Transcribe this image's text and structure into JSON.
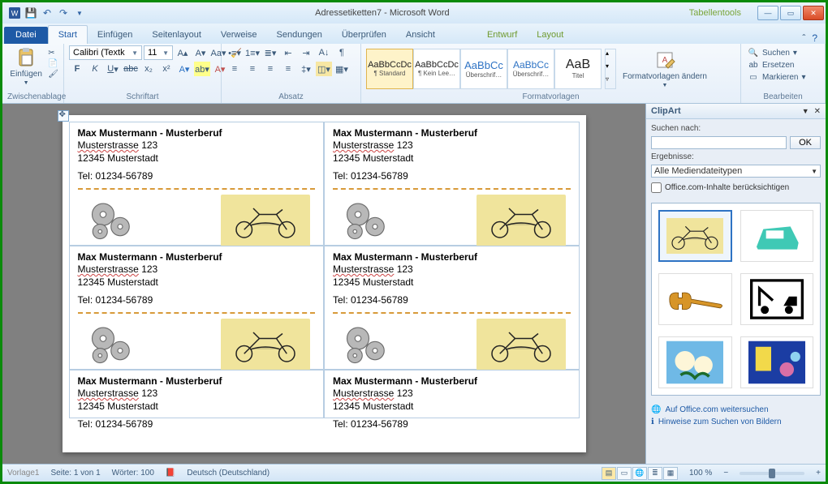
{
  "title": {
    "doc": "Adressetiketten7",
    "app": "Microsoft Word",
    "context_tool": "Tabellentools"
  },
  "tabs": {
    "file": "Datei",
    "items": [
      "Start",
      "Einfügen",
      "Seitenlayout",
      "Verweise",
      "Sendungen",
      "Überprüfen",
      "Ansicht"
    ],
    "context": [
      "Entwurf",
      "Layout"
    ]
  },
  "ribbon": {
    "clipboard": {
      "paste": "Einfügen",
      "label": "Zwischenablage"
    },
    "font": {
      "name": "Calibri (Textk",
      "size": "11",
      "label": "Schriftart"
    },
    "para": {
      "label": "Absatz"
    },
    "styles": {
      "label": "Formatvorlagen",
      "change": "Formatvorlagen ändern",
      "items": [
        {
          "sample": "AaBbCcDc",
          "name": "¶ Standard"
        },
        {
          "sample": "AaBbCcDc",
          "name": "¶ Kein Lee…"
        },
        {
          "sample": "AaBbCc",
          "name": "Überschrif…"
        },
        {
          "sample": "AaBbCc",
          "name": "Überschrif…"
        },
        {
          "sample": "AaB",
          "name": "Titel"
        }
      ]
    },
    "editing": {
      "label": "Bearbeiten",
      "find": "Suchen",
      "replace": "Ersetzen",
      "select": "Markieren"
    }
  },
  "label": {
    "name": "Max Mustermann - Musterberuf",
    "street_u": "Musterstrasse",
    "street_no": " 123",
    "city": "12345  Musterstadt",
    "tel": "Tel: 01234-56789"
  },
  "pane": {
    "title": "ClipArt",
    "search_label": "Suchen nach:",
    "ok": "OK",
    "results_label": "Ergebnisse:",
    "combo": "Alle Mediendateitypen",
    "office_check": "Office.com-Inhalte berücksichtigen",
    "link1": "Auf Office.com weitersuchen",
    "link2": "Hinweise zum Suchen von Bildern"
  },
  "status": {
    "page": "Seite: 1 von 1",
    "words": "Wörter: 100",
    "lang": "Deutsch (Deutschland)",
    "zoom": "100 %",
    "template": "Vorlage1"
  }
}
